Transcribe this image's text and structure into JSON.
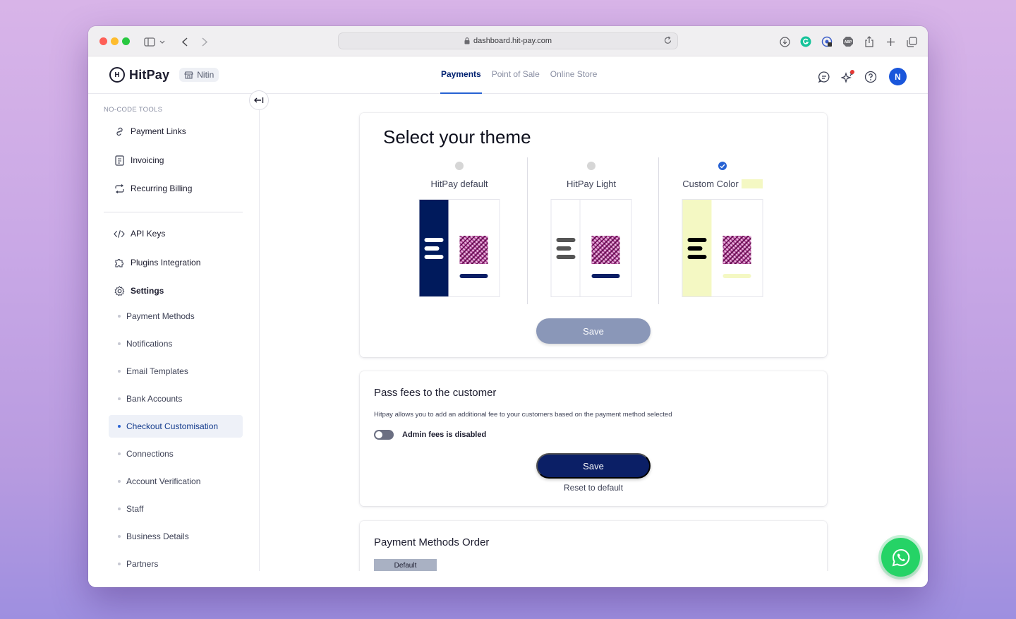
{
  "browser": {
    "url": "dashboard.hit-pay.com"
  },
  "header": {
    "logo_text": "HitPay",
    "store_name": "Nitin",
    "tabs": [
      {
        "label": "Payments",
        "active": true
      },
      {
        "label": "Point of Sale",
        "active": false
      },
      {
        "label": "Online Store",
        "active": false
      }
    ],
    "avatar_initial": "N"
  },
  "sidebar": {
    "section_title": "NO-CODE TOOLS",
    "tools": [
      {
        "label": "Payment Links",
        "icon": "link-icon"
      },
      {
        "label": "Invoicing",
        "icon": "invoice-icon"
      },
      {
        "label": "Recurring Billing",
        "icon": "repeat-icon"
      }
    ],
    "developer": [
      {
        "label": "API Keys",
        "icon": "code-icon"
      },
      {
        "label": "Plugins Integration",
        "icon": "puzzle-icon"
      },
      {
        "label": "Settings",
        "icon": "gear-icon"
      }
    ],
    "settings_items": [
      {
        "label": "Payment Methods",
        "active": false
      },
      {
        "label": "Notifications",
        "active": false
      },
      {
        "label": "Email Templates",
        "active": false
      },
      {
        "label": "Bank Accounts",
        "active": false
      },
      {
        "label": "Checkout Customisation",
        "active": true
      },
      {
        "label": "Connections",
        "active": false
      },
      {
        "label": "Account Verification",
        "active": false
      },
      {
        "label": "Staff",
        "active": false
      },
      {
        "label": "Business Details",
        "active": false
      },
      {
        "label": "Partners",
        "active": false
      }
    ]
  },
  "theme": {
    "title": "Select your theme",
    "options": [
      {
        "label": "HitPay default",
        "selected": false,
        "sidebar_color": "#001a5c",
        "line_color": "#ffffff",
        "button_color": "#0b1f66"
      },
      {
        "label": "HitPay Light",
        "selected": false,
        "sidebar_color": "#ffffff",
        "line_color": "#555555",
        "button_color": "#0b1f66"
      },
      {
        "label": "Custom Color",
        "selected": true,
        "sidebar_color": "#f4f8c3",
        "line_color": "#000000",
        "button_color": "#f4f8c3"
      }
    ],
    "save_label": "Save"
  },
  "fees": {
    "title": "Pass fees to the customer",
    "description": "Hitpay allows you to add an additional fee to your customers based on the payment method selected",
    "toggle_label": "Admin fees is disabled",
    "toggle_on": false,
    "save_label": "Save",
    "reset_label": "Reset to default"
  },
  "order": {
    "title": "Payment Methods Order",
    "default_label": "Default"
  },
  "colors": {
    "accent": "#2762d3",
    "navy": "#0b1f66",
    "whatsapp": "#25d366"
  }
}
